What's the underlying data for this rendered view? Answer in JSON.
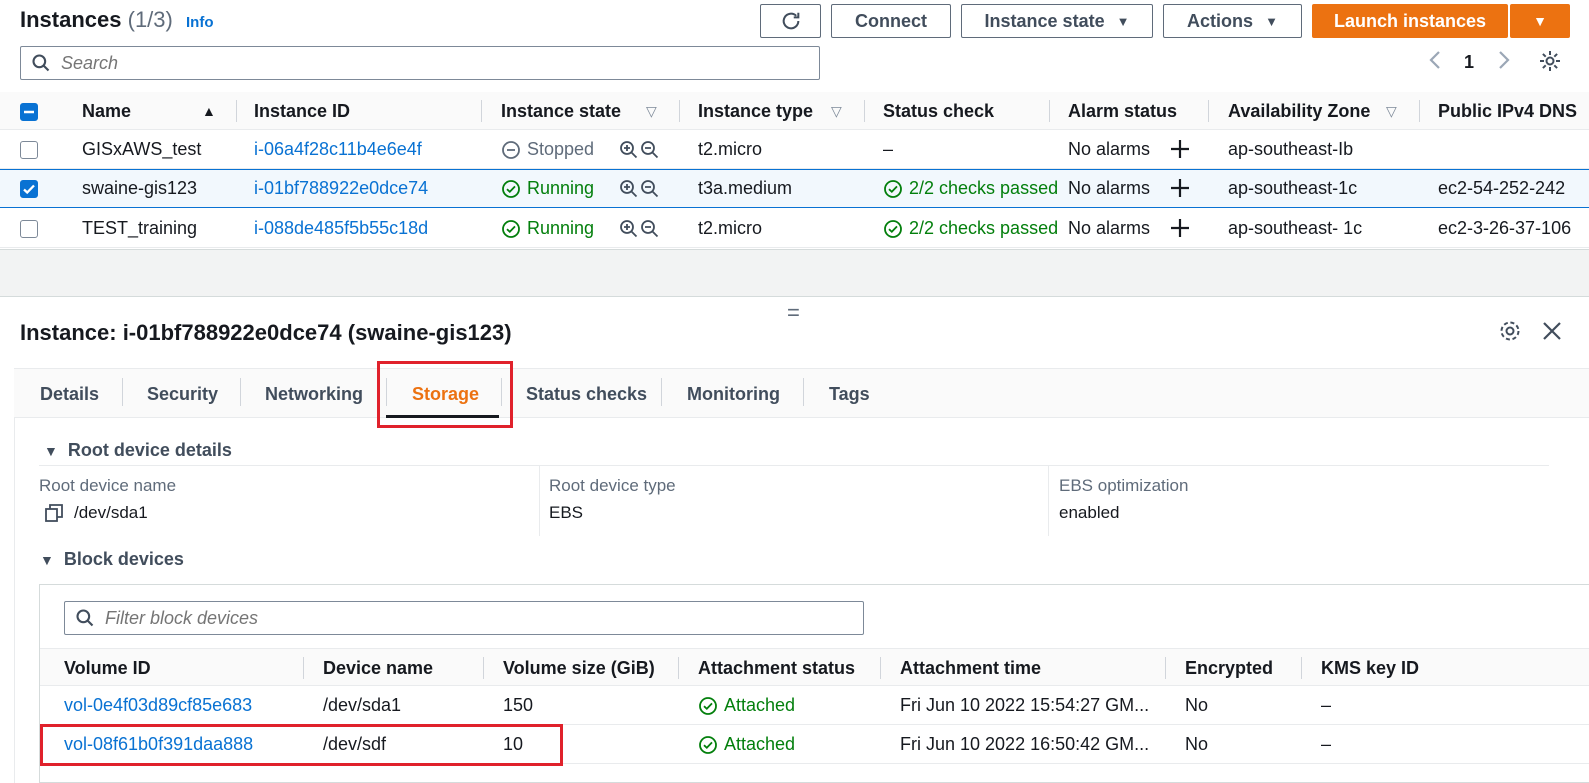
{
  "header": {
    "title": "Instances",
    "count": "(1/3)",
    "info_label": "Info",
    "search_placeholder": "Search",
    "connect_label": "Connect",
    "instance_state_label": "Instance state",
    "actions_label": "Actions",
    "launch_label": "Launch instances",
    "page_number": "1"
  },
  "instances": {
    "columns": [
      "Name",
      "Instance ID",
      "Instance state",
      "Instance type",
      "Status check",
      "Alarm status",
      "Availability Zone",
      "Public IPv4 DNS"
    ],
    "rows": [
      {
        "name": "GISxAWS_test",
        "id": "i-06a4f28c11b4e6e4f",
        "state": "Stopped",
        "type": "t2.micro",
        "status": "–",
        "alarm": "No alarms",
        "zone": "ap-southeast-Ib",
        "dns": "",
        "selected": false
      },
      {
        "name": "swaine-gis123",
        "id": "i-01bf788922e0dce74",
        "state": "Running",
        "type": "t3a.medium",
        "status": "2/2 checks passed",
        "alarm": "No alarms",
        "zone": "ap-southeast-1c",
        "dns": "ec2-54-252-242",
        "selected": true
      },
      {
        "name": "TEST_training",
        "id": "i-088de485f5b55c18d",
        "state": "Running",
        "type": "t2.micro",
        "status": "2/2 checks passed",
        "alarm": "No alarms",
        "zone": "ap-southeast- 1c",
        "dns": "ec2-3-26-37-106",
        "selected": false
      }
    ]
  },
  "detail": {
    "title": "Instance: i-01bf788922e0dce74 (swaine-gis123)",
    "tabs": [
      "Details",
      "Security",
      "Networking",
      "Storage",
      "Status checks",
      "Monitoring",
      "Tags"
    ],
    "active_tab": "Storage",
    "root_section": "Root device details",
    "root_name_label": "Root device name",
    "root_name_value": "/dev/sda1",
    "root_type_label": "Root device type",
    "root_type_value": "EBS",
    "ebs_label": "EBS optimization",
    "ebs_value": "enabled",
    "block_section": "Block devices",
    "filter_placeholder": "Filter block devices",
    "block_columns": [
      "Volume ID",
      "Device name",
      "Volume size (GiB)",
      "Attachment status",
      "Attachment time",
      "Encrypted",
      "KMS key ID"
    ],
    "block_rows": [
      {
        "volume_id": "vol-0e4f03d89cf85e683",
        "device": "/dev/sda1",
        "size": "150",
        "status": "Attached",
        "time": "Fri Jun 10 2022 15:54:27 GM...",
        "encrypted": "No",
        "kms": "–"
      },
      {
        "volume_id": "vol-08f61b0f391daa888",
        "device": "/dev/sdf",
        "size": "10",
        "status": "Attached",
        "time": "Fri Jun 10 2022 16:50:42 GM...",
        "encrypted": "No",
        "kms": "–"
      }
    ]
  },
  "colors": {
    "accent": "#ec7211",
    "link": "#0972d3",
    "success": "#037f0c",
    "highlight": "#e0212b"
  }
}
